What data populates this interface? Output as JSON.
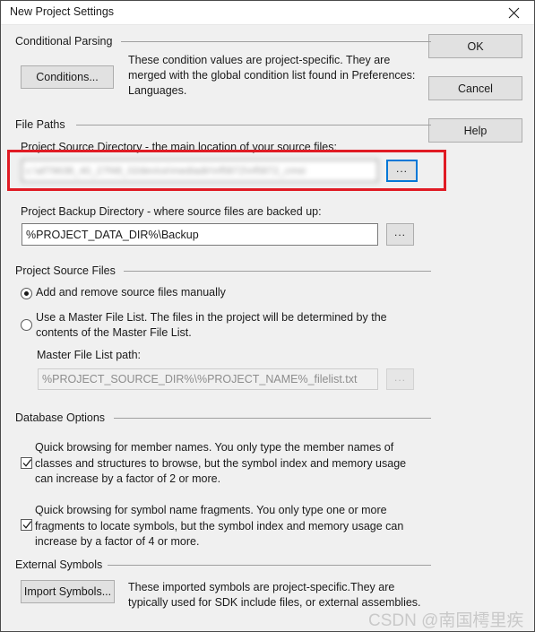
{
  "window": {
    "title": "New Project Settings",
    "close_icon": "close-icon"
  },
  "action_buttons": {
    "ok": "OK",
    "cancel": "Cancel",
    "help": "Help"
  },
  "groups": {
    "conditional_parsing": {
      "label": "Conditional Parsing",
      "button": "Conditions...",
      "description": "These condition values are project-specific.  They are merged with the global condition list found in Preferences: Languages."
    },
    "file_paths": {
      "label": "File Paths",
      "source_label": "Project Source Directory - the main location of your source files:",
      "source_value": "c:\\af79638_40_27f48_02device\\mediadir\\nf5872\\nf5872_cmsi",
      "source_browse": "...",
      "backup_label": "Project Backup Directory - where source files are backed up:",
      "backup_value": "%PROJECT_DATA_DIR%\\Backup",
      "backup_browse": "..."
    },
    "project_source_files": {
      "label": "Project Source Files",
      "radio_manual": "Add and remove source files manually",
      "radio_master": "Use a Master File List. The files in the project will be determined by the contents of the Master File List.",
      "master_path_label": "Master File List path:",
      "master_path_value": "%PROJECT_SOURCE_DIR%\\%PROJECT_NAME%_filelist.txt",
      "master_browse": "...",
      "selected": "manual"
    },
    "database_options": {
      "label": "Database Options",
      "option_member_names": "Quick browsing for member names.  You only type the member names of classes and structures to browse, but the symbol index and memory usage can increase by a factor of 2 or more.",
      "option_member_names_checked": true,
      "option_name_fragments": "Quick browsing for symbol name fragments.  You only type one or more fragments to locate symbols, but the symbol index and memory usage can increase by a factor of 4 or more.",
      "option_name_fragments_checked": true
    },
    "external_symbols": {
      "label": "External Symbols",
      "button": "Import Symbols...",
      "description": "These imported symbols are project-specific.They are typically used for SDK include files, or external assemblies."
    }
  },
  "annotation": {
    "highlight_color": "#e01b24"
  },
  "watermark": {
    "text": "CSDN @南国樗里疾"
  }
}
